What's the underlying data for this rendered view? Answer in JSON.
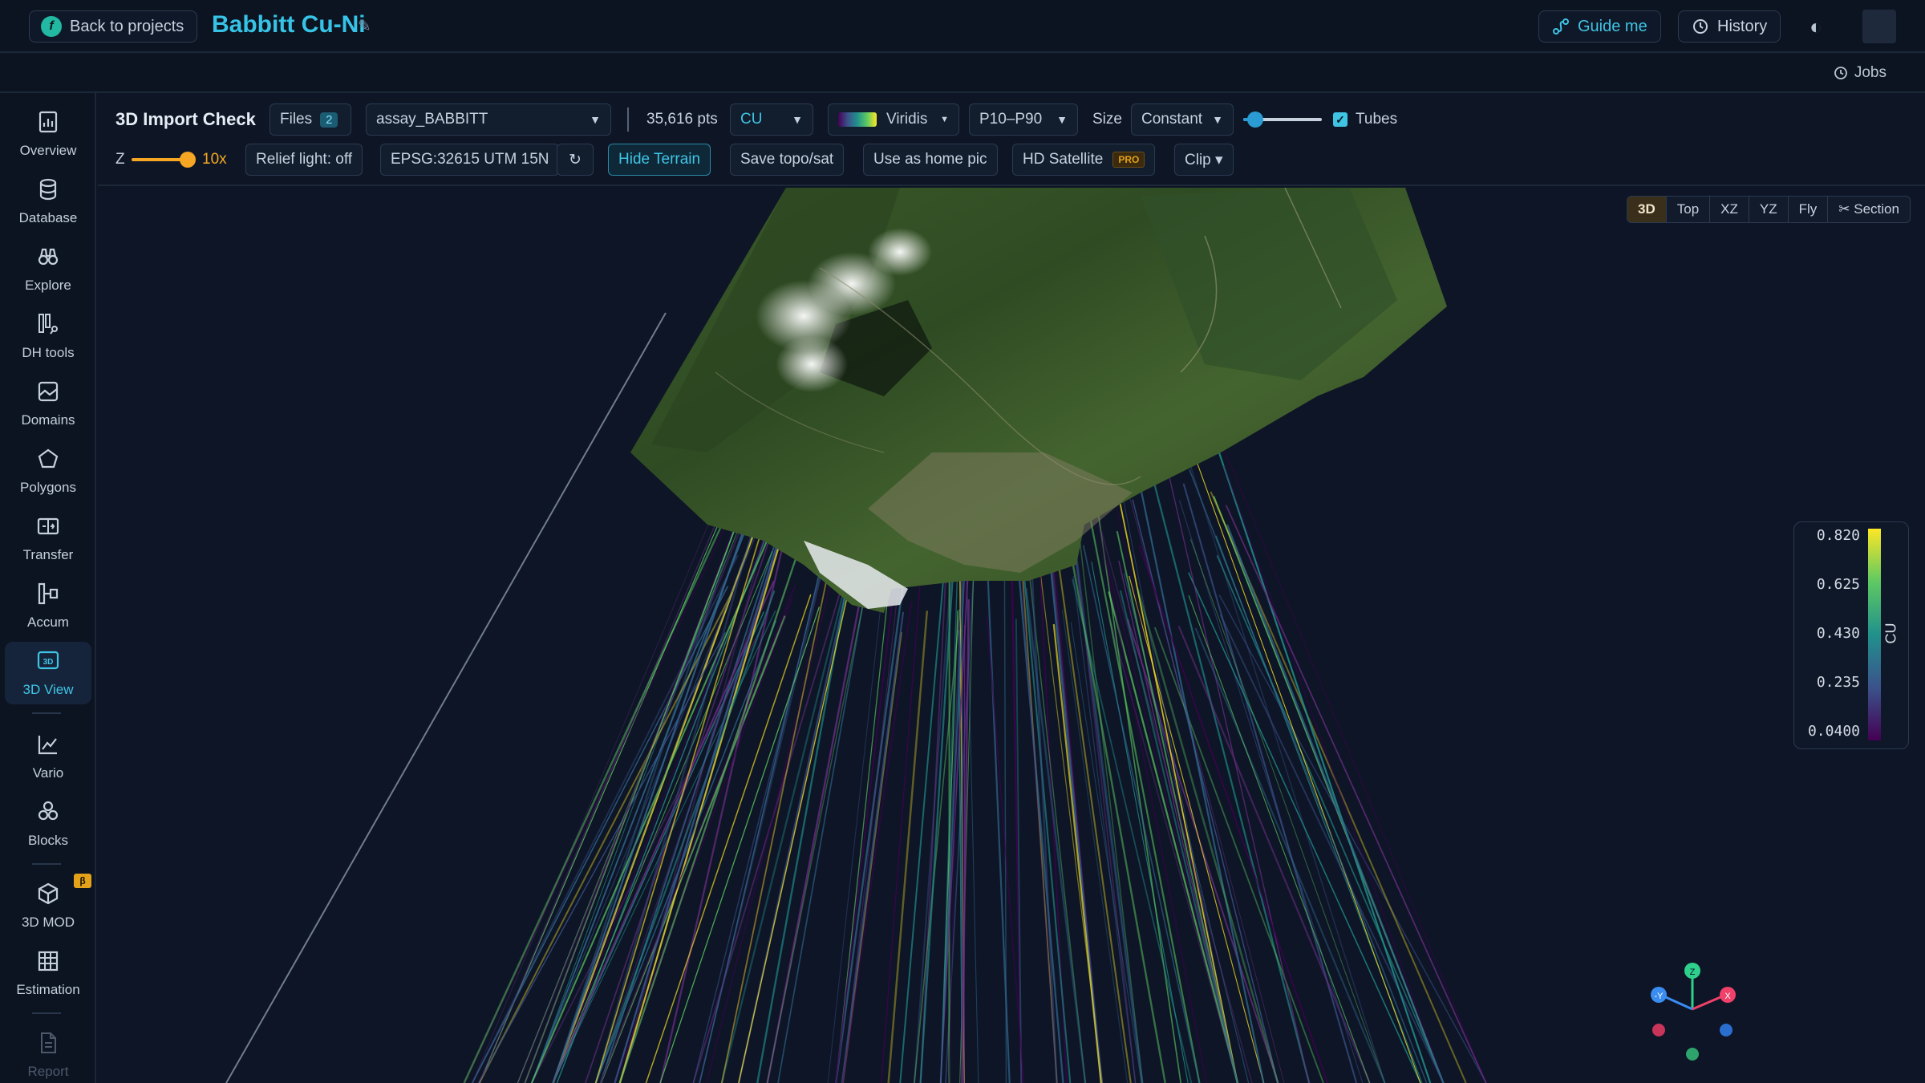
{
  "header": {
    "back_label": "Back to projects",
    "project_title": "Babbitt Cu-Ni",
    "guide_label": "Guide me",
    "history_label": "History"
  },
  "jobs_label": "Jobs",
  "sidebar": {
    "items": [
      {
        "label": "Overview",
        "icon": "overview-icon"
      },
      {
        "label": "Database",
        "icon": "database-icon"
      },
      {
        "label": "Explore",
        "icon": "binoculars-icon"
      },
      {
        "label": "DH tools",
        "icon": "drillhole-tools-icon"
      },
      {
        "label": "Domains",
        "icon": "domains-icon"
      },
      {
        "label": "Polygons",
        "icon": "polygon-icon"
      },
      {
        "label": "Transfer",
        "icon": "transfer-icon"
      },
      {
        "label": "Accum",
        "icon": "accum-icon"
      },
      {
        "label": "3D View",
        "icon": "3d-view-icon",
        "active": true
      },
      {
        "label": "Vario",
        "icon": "chart-line-icon"
      },
      {
        "label": "Blocks",
        "icon": "blocks-icon"
      },
      {
        "label": "3D MOD",
        "icon": "cube-icon",
        "badge": "β"
      },
      {
        "label": "Estimation",
        "icon": "grid-icon"
      },
      {
        "label": "Report",
        "icon": "report-icon",
        "disabled": true
      }
    ]
  },
  "toolbar": {
    "title": "3D Import Check",
    "files_label": "Files",
    "files_count": "2",
    "dataset": "assay_BABBITT",
    "points": "35,616 pts",
    "variable": "CU",
    "colormap": "Viridis",
    "range": "P10–P90",
    "size_label": "Size",
    "size_mode": "Constant",
    "size_slider_value": 0.15,
    "tubes_label": "Tubes",
    "tubes_checked": true,
    "z_label": "Z",
    "z_value": "10x",
    "z_slider_value": 1.0,
    "relief_label": "Relief light: off",
    "crs_label": "EPSG:32615 UTM 15N",
    "refresh_icon": "↻",
    "hide_terrain_label": "Hide Terrain",
    "save_topo_label": "Save topo/sat",
    "home_pic_label": "Use as home pic",
    "hd_satellite_label": "HD Satellite",
    "pro_badge": "PRO",
    "clip_label": "Clip ▾"
  },
  "view_tabs": [
    "3D",
    "Top",
    "XZ",
    "YZ",
    "Fly",
    "✂ Section"
  ],
  "active_view": "3D",
  "colorbar": {
    "variable": "CU",
    "ticks": [
      "0.820",
      "0.625",
      "0.430",
      "0.235",
      "0.0400"
    ],
    "min": 0.04,
    "max": 0.82
  },
  "axis_gizmo": {
    "z": "Z",
    "y": "-Y",
    "x": "X"
  },
  "colors": {
    "accent": "#3fc4e4",
    "slider": "#f5a623",
    "active_tab": "#3a2f1a"
  }
}
